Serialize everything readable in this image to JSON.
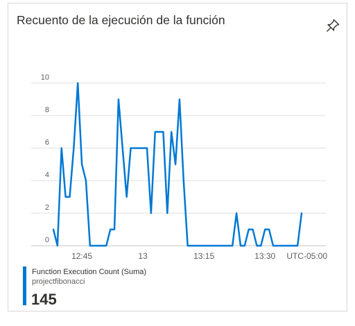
{
  "tile": {
    "title": "Recuento de la ejecución de la función",
    "pin_icon": "pin-icon"
  },
  "legend": {
    "series_name": "Function Execution Count (Suma)",
    "resource": "projectfibonacci",
    "total": "145",
    "color": "#0078d4"
  },
  "chart_data": {
    "type": "line",
    "ylim": [
      0,
      10
    ],
    "y_ticks": [
      "0",
      "2",
      "4",
      "6",
      "8",
      "10"
    ],
    "x_ticks": [
      "12:45",
      "13",
      "13:15",
      "13:30"
    ],
    "timezone": "UTC-05:00",
    "grid": true,
    "series": [
      {
        "name": "Function Execution Count (Suma)",
        "color": "#0078d4",
        "x": [
          "12:38",
          "12:39",
          "12:40",
          "12:41",
          "12:42",
          "12:43",
          "12:44",
          "12:45",
          "12:46",
          "12:47",
          "12:48",
          "12:49",
          "12:50",
          "12:51",
          "12:52",
          "12:53",
          "12:54",
          "12:55",
          "12:56",
          "12:57",
          "12:58",
          "12:59",
          "13:00",
          "13:01",
          "13:02",
          "13:03",
          "13:04",
          "13:05",
          "13:06",
          "13:07",
          "13:08",
          "13:09",
          "13:10",
          "13:11",
          "13:12",
          "13:13",
          "13:14",
          "13:15",
          "13:16",
          "13:17",
          "13:18",
          "13:19",
          "13:20",
          "13:21",
          "13:22",
          "13:23",
          "13:24",
          "13:25",
          "13:26",
          "13:27",
          "13:28",
          "13:29",
          "13:30",
          "13:31",
          "13:32",
          "13:33",
          "13:34",
          "13:35",
          "13:36",
          "13:37",
          "13:38",
          "13:39"
        ],
        "values": [
          1,
          0,
          6,
          3,
          3,
          6,
          10,
          5,
          4,
          0,
          0,
          0,
          0,
          0,
          1,
          1,
          9,
          6,
          3,
          6,
          6,
          6,
          6,
          6,
          2,
          7,
          7,
          7,
          2,
          7,
          5,
          9,
          4,
          0,
          0,
          0,
          0,
          0,
          0,
          0,
          0,
          0,
          0,
          0,
          0,
          2,
          0,
          0,
          1,
          1,
          0,
          0,
          1,
          1,
          0,
          0,
          0,
          0,
          0,
          0,
          0,
          2
        ]
      }
    ]
  }
}
